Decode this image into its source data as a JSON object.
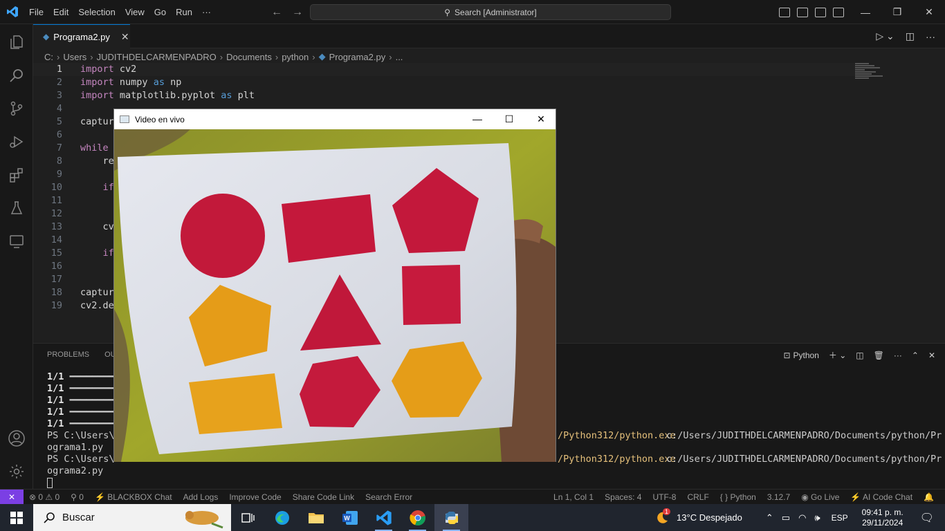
{
  "titlebar": {
    "menu": [
      "File",
      "Edit",
      "Selection",
      "View",
      "Go",
      "Run",
      "···"
    ],
    "search_text": "Search [Administrator]"
  },
  "tab": {
    "label": "Programa2.py",
    "close": "✕"
  },
  "breadcrumb": [
    "C:",
    "Users",
    "JUDITHDELCARMENPADRO",
    "Documents",
    "python",
    "Programa2.py",
    "..."
  ],
  "code": {
    "line_numbers": [
      "1",
      "2",
      "3",
      "4",
      "5",
      "6",
      "7",
      "8",
      "9",
      "10",
      "11",
      "12",
      "13",
      "14",
      "15",
      "16",
      "17",
      "18",
      "19"
    ],
    "lines": [
      {
        "kw": "import",
        "rest": " cv2"
      },
      {
        "kw": "import",
        "rest": " numpy ",
        "kw2": "as",
        "rest2": " np"
      },
      {
        "kw": "import",
        "rest": " matplotlib.pyplot ",
        "kw2": "as",
        "rest2": " plt"
      },
      {
        "text": ""
      },
      {
        "text": "captur"
      },
      {
        "text": ""
      },
      {
        "kw": "while",
        "rest": ""
      },
      {
        "text": "    re"
      },
      {
        "text": ""
      },
      {
        "kw": "    if",
        "rest": ""
      },
      {
        "text": ""
      },
      {
        "text": ""
      },
      {
        "text": "    cv"
      },
      {
        "text": ""
      },
      {
        "kw": "    if",
        "rest": ""
      },
      {
        "text": ""
      },
      {
        "text": ""
      },
      {
        "text": "captur"
      },
      {
        "text": "cv2.de"
      }
    ]
  },
  "panel": {
    "tabs": [
      "PROBLEMS",
      "OUT"
    ],
    "terminal_label": "Python",
    "terminal_lines": [
      {
        "bold": "1/1",
        "rest": " ━━━━━━━━━━"
      },
      {
        "bold": "1/1",
        "rest": " ━━━━━━━━━━"
      },
      {
        "bold": "1/1",
        "rest": " ━━━━━━━━━━"
      },
      {
        "bold": "1/1",
        "rest": " ━━━━━━━━━━"
      },
      {
        "bold": "1/1",
        "rest": " ━━━━━━━━━━"
      }
    ],
    "ps1": "PS C:\\Users\\J",
    "cmd_exe": "/Python312/python.exe",
    "cmd_path1": " c:/Users/JUDITHDELCARMENPADRO/Documents/python/Pr",
    "cont1": "ograma1.py",
    "ps2": "PS C:\\Users\\J",
    "cmd_path2": " c:/Users/JUDITHDELCARMENPADRO/Documents/python/Pr",
    "cont2": "ograma2.py"
  },
  "status": {
    "left": [
      "⊗ 0 ⚠ 0",
      "⚲ 0",
      "⚡ BLACKBOX Chat",
      "Add Logs",
      "Improve Code",
      "Share Code Link",
      "Search Error"
    ],
    "right": [
      "Ln 1, Col 1",
      "Spaces: 4",
      "UTF-8",
      "CRLF",
      "{ } Python",
      "3.12.7",
      "◉ Go Live",
      "⚡ AI Code Chat",
      "🔔"
    ]
  },
  "video_window": {
    "title": "Video en vivo"
  },
  "taskbar": {
    "search_label": "Buscar",
    "weather": "13°C  Despejado",
    "lang": "ESP",
    "time": "09:41 p. m.",
    "date": "29/11/2024",
    "badge": "1"
  }
}
